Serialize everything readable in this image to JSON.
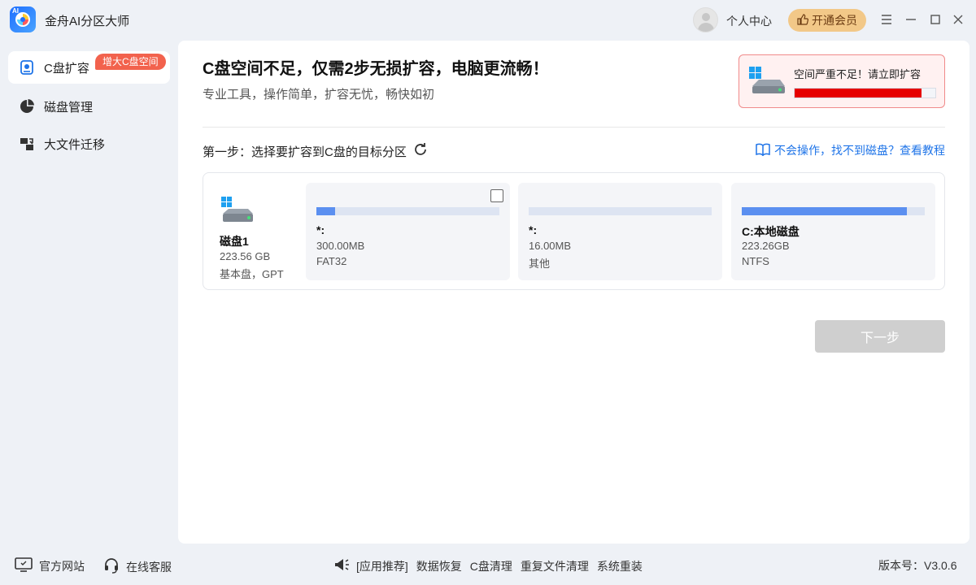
{
  "app": {
    "title": "金舟AI分区大师",
    "logo_tag": "AI"
  },
  "titlebar": {
    "user_center": "个人中心",
    "vip_button": "开通会员"
  },
  "sidebar": {
    "items": [
      {
        "label": "C盘扩容",
        "icon": "c-drive-icon"
      },
      {
        "label": "磁盘管理",
        "icon": "pie-chart-icon"
      },
      {
        "label": "大文件迁移",
        "icon": "file-transfer-icon"
      }
    ],
    "promo_badge": "增大C盘空间"
  },
  "main": {
    "headline": "C盘空间不足，仅需2步无损扩容，电脑更流畅！",
    "subline": "专业工具，操作简单，扩容无忧，畅快如初",
    "alert": {
      "text": "空间严重不足！请立即扩容",
      "usage_fraction": 0.9,
      "color": "#e60000"
    },
    "step_label": "第一步：选择要扩容到C盘的目标分区",
    "help_link": "不会操作，找不到磁盘？查看教程",
    "disk": {
      "name": "磁盘1",
      "size": "223.56 GB",
      "type": "基本盘，GPT"
    },
    "partitions": [
      {
        "name": "*:",
        "size": "300.00MB",
        "fs": "FAT32",
        "usage_fraction": 0.1,
        "checkbox": true
      },
      {
        "name": "*:",
        "size": "16.00MB",
        "fs": "其他",
        "usage_fraction": 0.0,
        "checkbox": false
      },
      {
        "name": "C:本地磁盘",
        "size": "223.26GB",
        "fs": "NTFS",
        "usage_fraction": 0.9,
        "checkbox": false
      }
    ],
    "next_button": "下一步"
  },
  "footer": {
    "official_site": "官方网站",
    "online_service": "在线客服",
    "recommend_label": "[应用推荐]",
    "recommend_links": [
      "数据恢复",
      "C盘清理",
      "重复文件清理",
      "系统重装"
    ],
    "version": "版本号：V3.0.6"
  },
  "colors": {
    "accent": "#1f74e8",
    "danger": "#e60000",
    "promo": "#f2624d",
    "vip": "#f2c888"
  }
}
